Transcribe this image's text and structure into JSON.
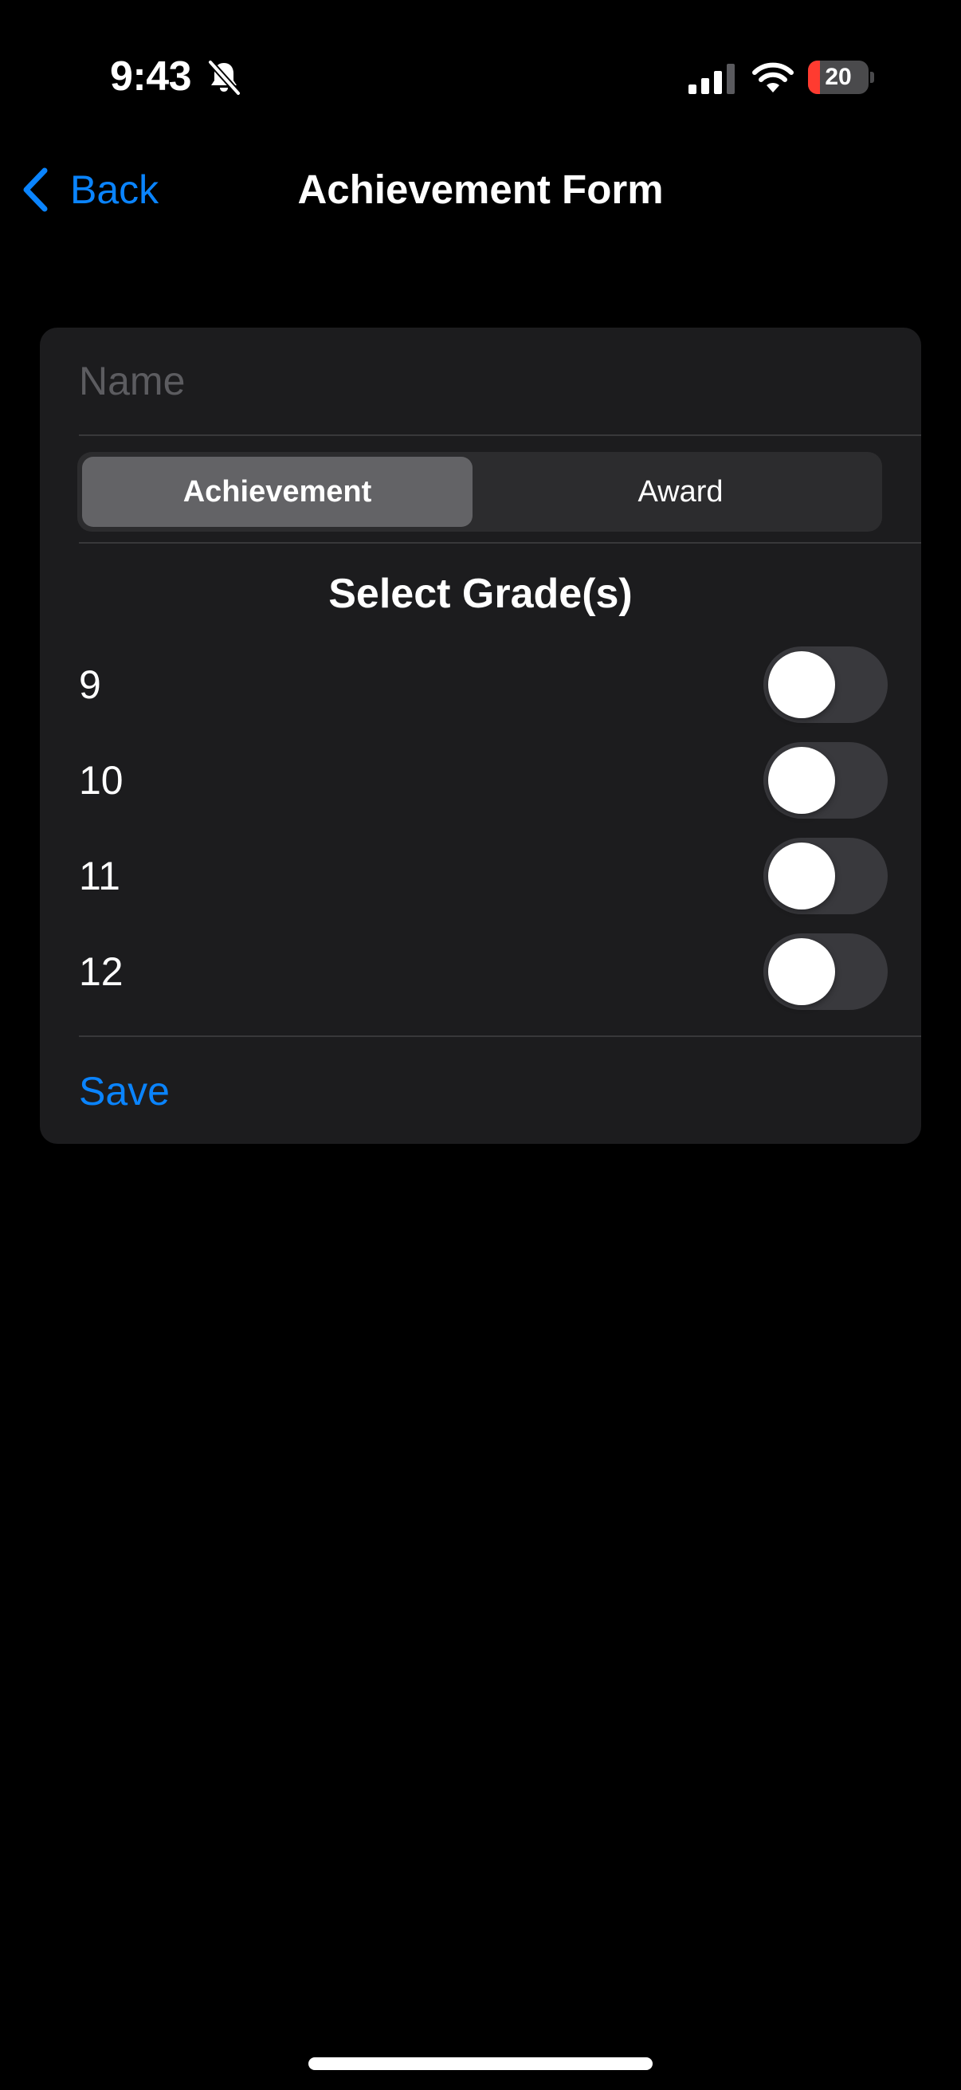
{
  "status_bar": {
    "time": "9:43",
    "battery_level": "20",
    "battery_fraction": 0.2,
    "icons": [
      "bell-slash-icon",
      "cellular-signal-icon",
      "wifi-icon",
      "battery-charging-icon"
    ]
  },
  "nav": {
    "back_label": "Back",
    "title": "Achievement Form"
  },
  "form": {
    "name_placeholder": "Name",
    "name_value": "",
    "segments": [
      {
        "label": "Achievement",
        "selected": true
      },
      {
        "label": "Award",
        "selected": false
      }
    ],
    "grades_title": "Select Grade(s)",
    "grades": [
      {
        "label": "9",
        "on": false
      },
      {
        "label": "10",
        "on": false
      },
      {
        "label": "11",
        "on": false
      },
      {
        "label": "12",
        "on": false
      }
    ],
    "save_label": "Save"
  },
  "colors": {
    "background": "#000000",
    "card": "#1c1c1e",
    "accent": "#0a84ff",
    "battery_low": "#ff3b30",
    "toggle_off": "#39393d"
  }
}
